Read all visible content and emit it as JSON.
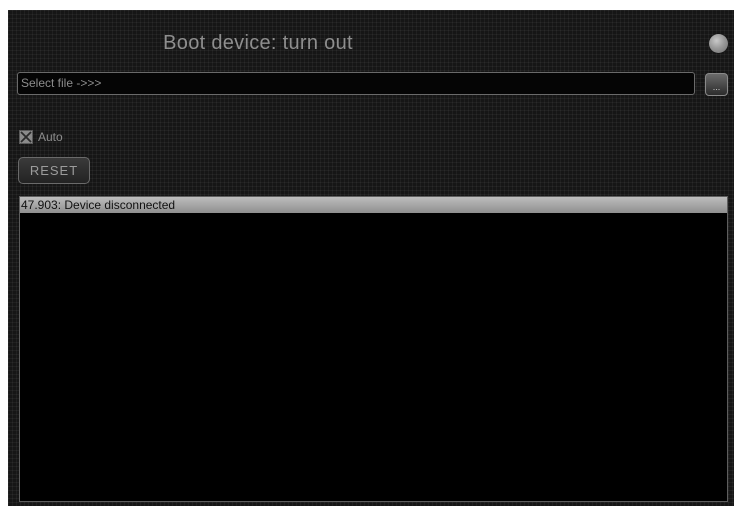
{
  "window": {
    "title": "Boot device: turn out"
  },
  "file_selector": {
    "value": "Select file ->>>",
    "browse_label": "..."
  },
  "auto": {
    "label": "Auto",
    "checked": true
  },
  "reset_button": {
    "label": "RESET"
  },
  "log": {
    "entries": [
      "47.903: Device disconnected"
    ]
  },
  "status_indicator": {
    "icon": "status-led-icon",
    "color": "#9a9a9a"
  }
}
